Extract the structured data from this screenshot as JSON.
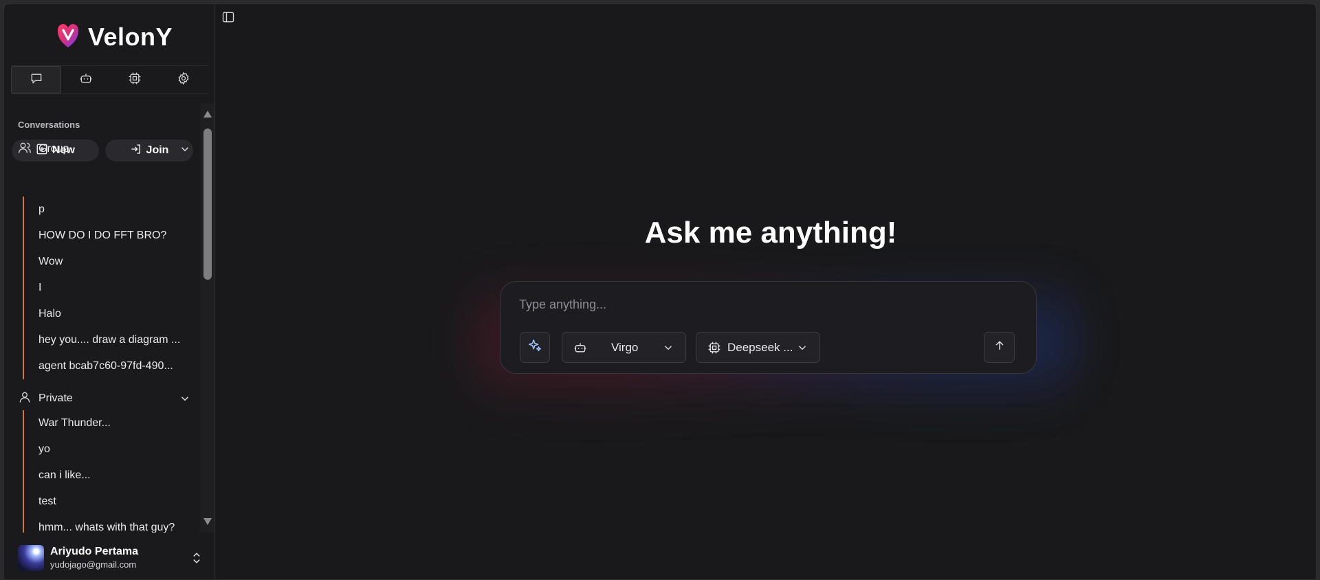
{
  "brand": {
    "name": "VelonY"
  },
  "nav_tabs": [
    {
      "name": "chat",
      "icon": "chat-icon",
      "active": true
    },
    {
      "name": "agents",
      "icon": "bot-icon",
      "active": false
    },
    {
      "name": "models",
      "icon": "cpu-icon",
      "active": false
    },
    {
      "name": "settings",
      "icon": "gear-icon",
      "active": false
    }
  ],
  "sidebar": {
    "section_label": "Conversations",
    "new_label": "New",
    "join_label": "Join",
    "groups": [
      {
        "label": "Group",
        "icon": "users-icon",
        "items": [
          "p",
          "HOW DO I DO FFT BRO?",
          "Wow",
          "I",
          "Halo",
          "hey you.... draw a diagram ...",
          "agent bcab7c60-97fd-490..."
        ]
      },
      {
        "label": "Private",
        "icon": "user-icon",
        "items": [
          "War Thunder...",
          "yo",
          "can i like...",
          "test",
          "hmm... whats with that guy?"
        ]
      }
    ]
  },
  "user": {
    "name": "Ariyudo Pertama",
    "email": "yudojago@gmail.com"
  },
  "main": {
    "title": "Ask me anything!",
    "composer": {
      "placeholder": "Type anything...",
      "agent_label": "Virgo",
      "model_label": "Deepseek ..."
    }
  },
  "colors": {
    "background": "#19191b",
    "sidebar": "#1a1a1d",
    "accent_line": "#d27a2a",
    "glow_red": "#be1e46",
    "glow_blue": "#2850dc"
  }
}
